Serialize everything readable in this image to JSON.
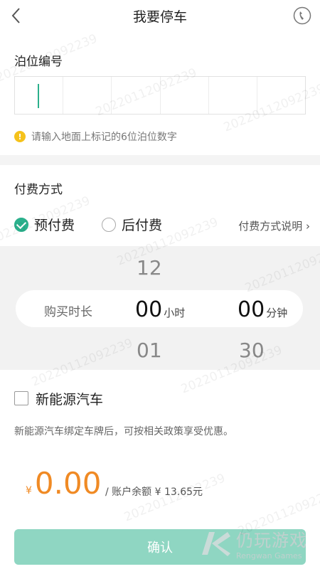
{
  "header": {
    "title": "我要停车"
  },
  "berth": {
    "label": "泊位编号",
    "hint": "请输入地面上标记的6位泊位数字"
  },
  "payment": {
    "label": "付费方式",
    "prepay": "预付费",
    "postpay": "后付费",
    "help": "付费方式说明 ›"
  },
  "duration": {
    "label": "购买时长",
    "hour_prev": "12",
    "hour_selected": "00",
    "hour_next": "01",
    "hour_unit": "小时",
    "minute_selected": "00",
    "minute_next": "30",
    "minute_unit": "分钟"
  },
  "nev": {
    "label": "新能源汽车",
    "desc": "新能源汽车绑定车牌后，可按相关政策享受优惠。"
  },
  "amount": {
    "currency": "¥",
    "value": "0.00",
    "balance": "/ 账户余额 ¥ 13.65元"
  },
  "confirm_label": "确认",
  "watermark": "20220112092239",
  "brand": {
    "cn": "仍玩游戏",
    "en": "Rengwan Games"
  },
  "colors": {
    "accent": "#2bb08c",
    "amount": "#f08a24",
    "confirm_bg": "#8fd6c2"
  }
}
